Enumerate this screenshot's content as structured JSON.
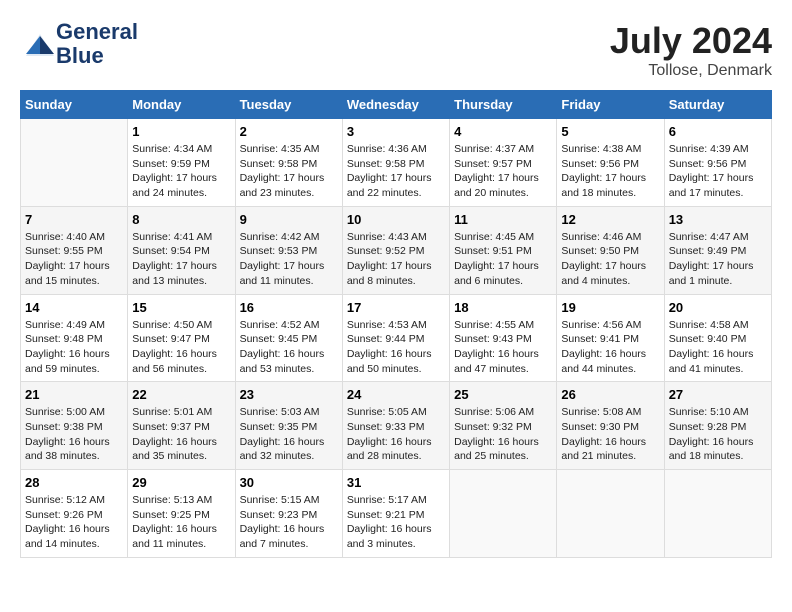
{
  "header": {
    "logo_line1": "General",
    "logo_line2": "Blue",
    "month_year": "July 2024",
    "location": "Tollose, Denmark"
  },
  "weekdays": [
    "Sunday",
    "Monday",
    "Tuesday",
    "Wednesday",
    "Thursday",
    "Friday",
    "Saturday"
  ],
  "weeks": [
    [
      {
        "day": "",
        "sunrise": "",
        "sunset": "",
        "daylight": ""
      },
      {
        "day": "1",
        "sunrise": "Sunrise: 4:34 AM",
        "sunset": "Sunset: 9:59 PM",
        "daylight": "Daylight: 17 hours and 24 minutes."
      },
      {
        "day": "2",
        "sunrise": "Sunrise: 4:35 AM",
        "sunset": "Sunset: 9:58 PM",
        "daylight": "Daylight: 17 hours and 23 minutes."
      },
      {
        "day": "3",
        "sunrise": "Sunrise: 4:36 AM",
        "sunset": "Sunset: 9:58 PM",
        "daylight": "Daylight: 17 hours and 22 minutes."
      },
      {
        "day": "4",
        "sunrise": "Sunrise: 4:37 AM",
        "sunset": "Sunset: 9:57 PM",
        "daylight": "Daylight: 17 hours and 20 minutes."
      },
      {
        "day": "5",
        "sunrise": "Sunrise: 4:38 AM",
        "sunset": "Sunset: 9:56 PM",
        "daylight": "Daylight: 17 hours and 18 minutes."
      },
      {
        "day": "6",
        "sunrise": "Sunrise: 4:39 AM",
        "sunset": "Sunset: 9:56 PM",
        "daylight": "Daylight: 17 hours and 17 minutes."
      }
    ],
    [
      {
        "day": "7",
        "sunrise": "Sunrise: 4:40 AM",
        "sunset": "Sunset: 9:55 PM",
        "daylight": "Daylight: 17 hours and 15 minutes."
      },
      {
        "day": "8",
        "sunrise": "Sunrise: 4:41 AM",
        "sunset": "Sunset: 9:54 PM",
        "daylight": "Daylight: 17 hours and 13 minutes."
      },
      {
        "day": "9",
        "sunrise": "Sunrise: 4:42 AM",
        "sunset": "Sunset: 9:53 PM",
        "daylight": "Daylight: 17 hours and 11 minutes."
      },
      {
        "day": "10",
        "sunrise": "Sunrise: 4:43 AM",
        "sunset": "Sunset: 9:52 PM",
        "daylight": "Daylight: 17 hours and 8 minutes."
      },
      {
        "day": "11",
        "sunrise": "Sunrise: 4:45 AM",
        "sunset": "Sunset: 9:51 PM",
        "daylight": "Daylight: 17 hours and 6 minutes."
      },
      {
        "day": "12",
        "sunrise": "Sunrise: 4:46 AM",
        "sunset": "Sunset: 9:50 PM",
        "daylight": "Daylight: 17 hours and 4 minutes."
      },
      {
        "day": "13",
        "sunrise": "Sunrise: 4:47 AM",
        "sunset": "Sunset: 9:49 PM",
        "daylight": "Daylight: 17 hours and 1 minute."
      }
    ],
    [
      {
        "day": "14",
        "sunrise": "Sunrise: 4:49 AM",
        "sunset": "Sunset: 9:48 PM",
        "daylight": "Daylight: 16 hours and 59 minutes."
      },
      {
        "day": "15",
        "sunrise": "Sunrise: 4:50 AM",
        "sunset": "Sunset: 9:47 PM",
        "daylight": "Daylight: 16 hours and 56 minutes."
      },
      {
        "day": "16",
        "sunrise": "Sunrise: 4:52 AM",
        "sunset": "Sunset: 9:45 PM",
        "daylight": "Daylight: 16 hours and 53 minutes."
      },
      {
        "day": "17",
        "sunrise": "Sunrise: 4:53 AM",
        "sunset": "Sunset: 9:44 PM",
        "daylight": "Daylight: 16 hours and 50 minutes."
      },
      {
        "day": "18",
        "sunrise": "Sunrise: 4:55 AM",
        "sunset": "Sunset: 9:43 PM",
        "daylight": "Daylight: 16 hours and 47 minutes."
      },
      {
        "day": "19",
        "sunrise": "Sunrise: 4:56 AM",
        "sunset": "Sunset: 9:41 PM",
        "daylight": "Daylight: 16 hours and 44 minutes."
      },
      {
        "day": "20",
        "sunrise": "Sunrise: 4:58 AM",
        "sunset": "Sunset: 9:40 PM",
        "daylight": "Daylight: 16 hours and 41 minutes."
      }
    ],
    [
      {
        "day": "21",
        "sunrise": "Sunrise: 5:00 AM",
        "sunset": "Sunset: 9:38 PM",
        "daylight": "Daylight: 16 hours and 38 minutes."
      },
      {
        "day": "22",
        "sunrise": "Sunrise: 5:01 AM",
        "sunset": "Sunset: 9:37 PM",
        "daylight": "Daylight: 16 hours and 35 minutes."
      },
      {
        "day": "23",
        "sunrise": "Sunrise: 5:03 AM",
        "sunset": "Sunset: 9:35 PM",
        "daylight": "Daylight: 16 hours and 32 minutes."
      },
      {
        "day": "24",
        "sunrise": "Sunrise: 5:05 AM",
        "sunset": "Sunset: 9:33 PM",
        "daylight": "Daylight: 16 hours and 28 minutes."
      },
      {
        "day": "25",
        "sunrise": "Sunrise: 5:06 AM",
        "sunset": "Sunset: 9:32 PM",
        "daylight": "Daylight: 16 hours and 25 minutes."
      },
      {
        "day": "26",
        "sunrise": "Sunrise: 5:08 AM",
        "sunset": "Sunset: 9:30 PM",
        "daylight": "Daylight: 16 hours and 21 minutes."
      },
      {
        "day": "27",
        "sunrise": "Sunrise: 5:10 AM",
        "sunset": "Sunset: 9:28 PM",
        "daylight": "Daylight: 16 hours and 18 minutes."
      }
    ],
    [
      {
        "day": "28",
        "sunrise": "Sunrise: 5:12 AM",
        "sunset": "Sunset: 9:26 PM",
        "daylight": "Daylight: 16 hours and 14 minutes."
      },
      {
        "day": "29",
        "sunrise": "Sunrise: 5:13 AM",
        "sunset": "Sunset: 9:25 PM",
        "daylight": "Daylight: 16 hours and 11 minutes."
      },
      {
        "day": "30",
        "sunrise": "Sunrise: 5:15 AM",
        "sunset": "Sunset: 9:23 PM",
        "daylight": "Daylight: 16 hours and 7 minutes."
      },
      {
        "day": "31",
        "sunrise": "Sunrise: 5:17 AM",
        "sunset": "Sunset: 9:21 PM",
        "daylight": "Daylight: 16 hours and 3 minutes."
      },
      {
        "day": "",
        "sunrise": "",
        "sunset": "",
        "daylight": ""
      },
      {
        "day": "",
        "sunrise": "",
        "sunset": "",
        "daylight": ""
      },
      {
        "day": "",
        "sunrise": "",
        "sunset": "",
        "daylight": ""
      }
    ]
  ]
}
